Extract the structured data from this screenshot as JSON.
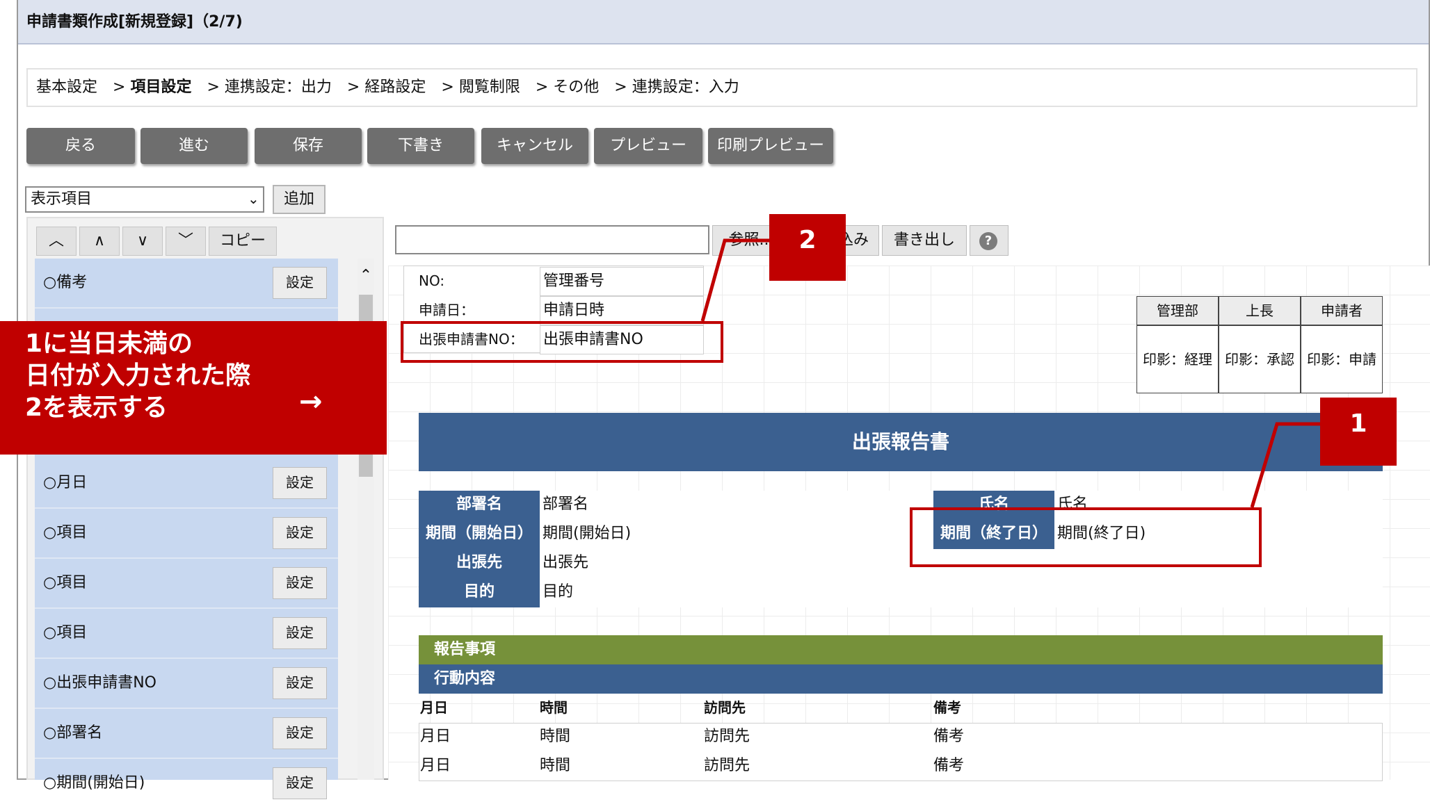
{
  "window": {
    "title": "申請書類作成[新規登録]（2/7)"
  },
  "breadcrumb": {
    "separator": ">",
    "steps": [
      "基本設定",
      "項目設定",
      "連携設定：出力",
      "経路設定",
      "閲覧制限",
      "その他",
      "連携設定：入力"
    ],
    "current_index": 1
  },
  "actions": [
    "戻る",
    "進む",
    "保存",
    "下書き",
    "キャンセル",
    "プレビュー",
    "印刷プレビュー"
  ],
  "item_select": {
    "value": "表示項目",
    "add_label": "追加"
  },
  "nav_buttons": {
    "top": "⩔",
    "up": "∧",
    "down": "∨",
    "bottom": "⩔",
    "copy": "コピー"
  },
  "item_list": [
    {
      "label": "○備考",
      "button": "設定"
    },
    {
      "label": "○月日",
      "button": "設定"
    },
    {
      "label": "○項目",
      "button": "設定"
    },
    {
      "label": "○項目",
      "button": "設定"
    },
    {
      "label": "○項目",
      "button": "設定"
    },
    {
      "label": "○出張申請書NO",
      "button": "設定"
    },
    {
      "label": "○部署名",
      "button": "設定"
    },
    {
      "label": "○期間(開始日)",
      "button": "設定"
    }
  ],
  "toolbar": {
    "path_value": "",
    "browse": "参照...",
    "import": "込み",
    "export": "書き出し",
    "help": "?"
  },
  "header_fields": [
    {
      "label": "NO:",
      "value": "管理番号"
    },
    {
      "label": "申請日：",
      "value": "申請日時"
    },
    {
      "label": "出張申請書NO：",
      "value": "出張申請書NO"
    }
  ],
  "stamps": {
    "headers": [
      "管理部",
      "上長",
      "申請者"
    ],
    "values": [
      "印影：経理",
      "印影：承認",
      "印影：申請"
    ]
  },
  "form": {
    "title": "出張報告書",
    "fields": {
      "dept_label": "部署名",
      "dept_value": "部署名",
      "name_label": "氏名",
      "name_value": "氏名",
      "start_label": "期間（開始日）",
      "start_value": "期間(開始日)",
      "end_label": "期間（終了日）",
      "end_value": "期間(終了日)",
      "dest_label": "出張先",
      "dest_value": "出張先",
      "purpose_label": "目的",
      "purpose_value": "目的"
    },
    "report_band": "報告事項",
    "activity_band": "行動内容",
    "activity_columns": [
      "月日",
      "時間",
      "訪問先",
      "備考"
    ],
    "activity_rows": [
      [
        "月日",
        "時間",
        "訪問先",
        "備考"
      ],
      [
        "月日",
        "時間",
        "訪問先",
        "備考"
      ]
    ]
  },
  "annotation": {
    "callout_lines": [
      "1に当日未満の",
      "日付が入力された際",
      "2を表示する"
    ],
    "callout_arrow": "→",
    "badge_1": "1",
    "badge_2": "2",
    "color": "#c00000"
  }
}
